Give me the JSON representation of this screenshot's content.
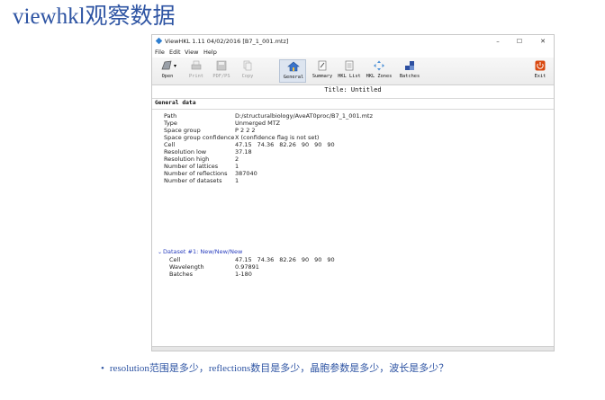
{
  "slide": {
    "title": "viewhkl观察数据",
    "question": "resolution范围是多少，reflections数目是多少，晶胞参数是多少，波长是多少？"
  },
  "window": {
    "title": "ViewHKL 1.11 04/02/2016 [B7_1_001.mtz]",
    "min": "–",
    "max": "☐",
    "close": "✕"
  },
  "menu": {
    "file": "File",
    "edit": "Edit",
    "view": "View",
    "help": "Help"
  },
  "toolbar": {
    "open": "Open",
    "print": "Print",
    "pdfps": "PDF/PS",
    "copy": "Copy",
    "general": "General",
    "summary": "Summary",
    "hkl_list": "HKL List",
    "hkl_zones": "HKL Zones",
    "batches": "Batches",
    "exit": "Exit"
  },
  "title_line": "Title: Untitled",
  "section": "General data",
  "general": [
    {
      "key": "Path",
      "value": "D:/structuralbiology/AveAT0proc/B7_1_001.mtz"
    },
    {
      "key": "Type",
      "value": "Unmerged MTZ"
    },
    {
      "key": "Space group",
      "value": "P 2 2 2"
    },
    {
      "key": "Space group confidence",
      "value": "X  (confidence flag is not set)"
    },
    {
      "key": "Cell",
      "values": [
        "47.15",
        "74.36",
        "82.26",
        "90",
        "90",
        "90"
      ]
    },
    {
      "key": "Resolution low",
      "value": "37.18"
    },
    {
      "key": "Resolution high",
      "value": "2"
    },
    {
      "key": "Number of lattices",
      "value": "1"
    },
    {
      "key": "Number of reflections",
      "value": "387040"
    },
    {
      "key": "Number of datasets",
      "value": "1"
    }
  ],
  "dataset": {
    "header": "Dataset #1: New/New/New",
    "cell_key": "Cell",
    "cell": [
      "47.15",
      "74.36",
      "82.26",
      "90",
      "90",
      "90"
    ],
    "wavelength_key": "Wavelength",
    "wavelength": "0.97891",
    "batches_key": "Batches",
    "batches": "1-180"
  },
  "colors": {
    "slide_text": "#2e54a3",
    "dataset_link": "#2a3fbf",
    "exit_red": "#d9480f"
  }
}
